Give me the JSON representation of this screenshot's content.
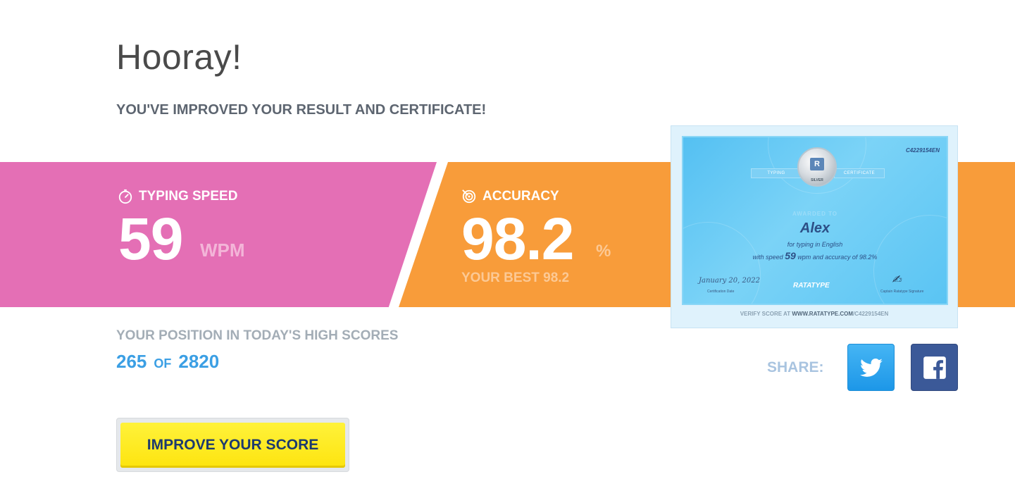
{
  "header": {
    "title": "Hooray!",
    "subtitle": "YOU'VE IMPROVED YOUR RESULT AND CERTIFICATE!"
  },
  "speed": {
    "label": "TYPING SPEED",
    "icon": "stopwatch-icon",
    "value": "59",
    "unit": "WPM",
    "band_color": "#e46fb5"
  },
  "accuracy": {
    "label": "ACCURACY",
    "icon": "target-icon",
    "value": "98.2",
    "unit": "%",
    "best": "YOUR BEST 98.2",
    "band_color": "#f89c3a"
  },
  "certificate": {
    "id": "C4229154EN",
    "ribbon_left": "TYPING",
    "ribbon_right": "CERTIFICATE",
    "medal": "SILVER",
    "awarded_to": "AWARDED TO",
    "name": "Alex",
    "line1": "for typing in English",
    "line2_prefix": "with speed",
    "line2_speed": "59",
    "line2_suffix": "wpm and accuracy of 98.2%",
    "date": "January 20, 2022",
    "date_caption": "Certification Date",
    "brand": "RATATYPE",
    "signature_caption": "Captain Ratatype Signature",
    "verify_prefix": "VERIFY SCORE AT",
    "verify_url": "WWW.RATATYPE.COM",
    "verify_path": "/C4229154EN"
  },
  "position": {
    "label": "YOUR POSITION IN TODAY'S HIGH SCORES",
    "rank": "265",
    "of": "OF",
    "total": "2820"
  },
  "share": {
    "label": "SHARE:",
    "twitter_icon": "twitter-icon",
    "facebook_icon": "facebook-icon"
  },
  "actions": {
    "improve_label": "IMPROVE YOUR SCORE"
  }
}
